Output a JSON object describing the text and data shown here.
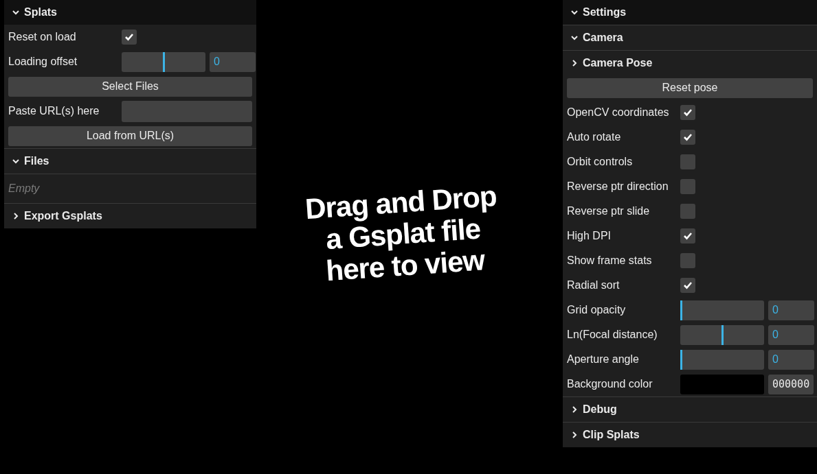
{
  "left_panel": {
    "items": [
      {
        "kind": "section",
        "title": "Splats",
        "expanded": true,
        "top": true,
        "items": [
          {
            "kind": "checkbox",
            "label": "Reset on load",
            "checked": true
          },
          {
            "kind": "slider",
            "label": "Loading offset",
            "level": 0.5,
            "value": "0"
          },
          {
            "kind": "button",
            "label": "Select Files"
          },
          {
            "kind": "text",
            "label": "Paste URL(s) here"
          },
          {
            "kind": "button",
            "label": "Load from URL(s)"
          }
        ]
      },
      {
        "kind": "section",
        "title": "Files",
        "expanded": true,
        "items": [
          {
            "kind": "empty",
            "label": "Empty"
          }
        ]
      },
      {
        "kind": "section",
        "title": "Export Gsplats",
        "expanded": false
      }
    ]
  },
  "drop_hint": {
    "lines": [
      "Drag and Drop",
      "a Gsplat file",
      "here to view"
    ]
  },
  "right_panel": {
    "items": [
      {
        "kind": "section",
        "title": "Settings",
        "expanded": true,
        "top": true,
        "items": [
          {
            "kind": "section",
            "title": "Camera",
            "expanded": true,
            "items": [
              {
                "kind": "section",
                "title": "Camera Pose",
                "expanded": false
              },
              {
                "kind": "button",
                "label": "Reset pose"
              },
              {
                "kind": "checkbox",
                "label": "OpenCV coordinates",
                "checked": true
              },
              {
                "kind": "checkbox",
                "label": "Auto rotate",
                "checked": true
              },
              {
                "kind": "checkbox",
                "label": "Orbit controls",
                "checked": false
              },
              {
                "kind": "checkbox",
                "label": "Reverse ptr direction",
                "checked": false
              },
              {
                "kind": "checkbox",
                "label": "Reverse ptr slide",
                "checked": false
              }
            ]
          },
          {
            "kind": "checkbox",
            "label": "High DPI",
            "checked": true
          },
          {
            "kind": "checkbox",
            "label": "Show frame stats",
            "checked": false
          },
          {
            "kind": "checkbox",
            "label": "Radial sort",
            "checked": true
          },
          {
            "kind": "slider",
            "label": "Grid opacity",
            "level": 0,
            "value": "0"
          },
          {
            "kind": "slider",
            "label": "Ln(Focal distance)",
            "level": 0.5,
            "value": "0"
          },
          {
            "kind": "slider",
            "label": "Aperture angle",
            "level": 0,
            "value": "0"
          },
          {
            "kind": "color",
            "label": "Background color",
            "value": "000000"
          },
          {
            "kind": "section",
            "title": "Debug",
            "expanded": false
          },
          {
            "kind": "section",
            "title": "Clip Splats",
            "expanded": false
          }
        ]
      }
    ]
  }
}
